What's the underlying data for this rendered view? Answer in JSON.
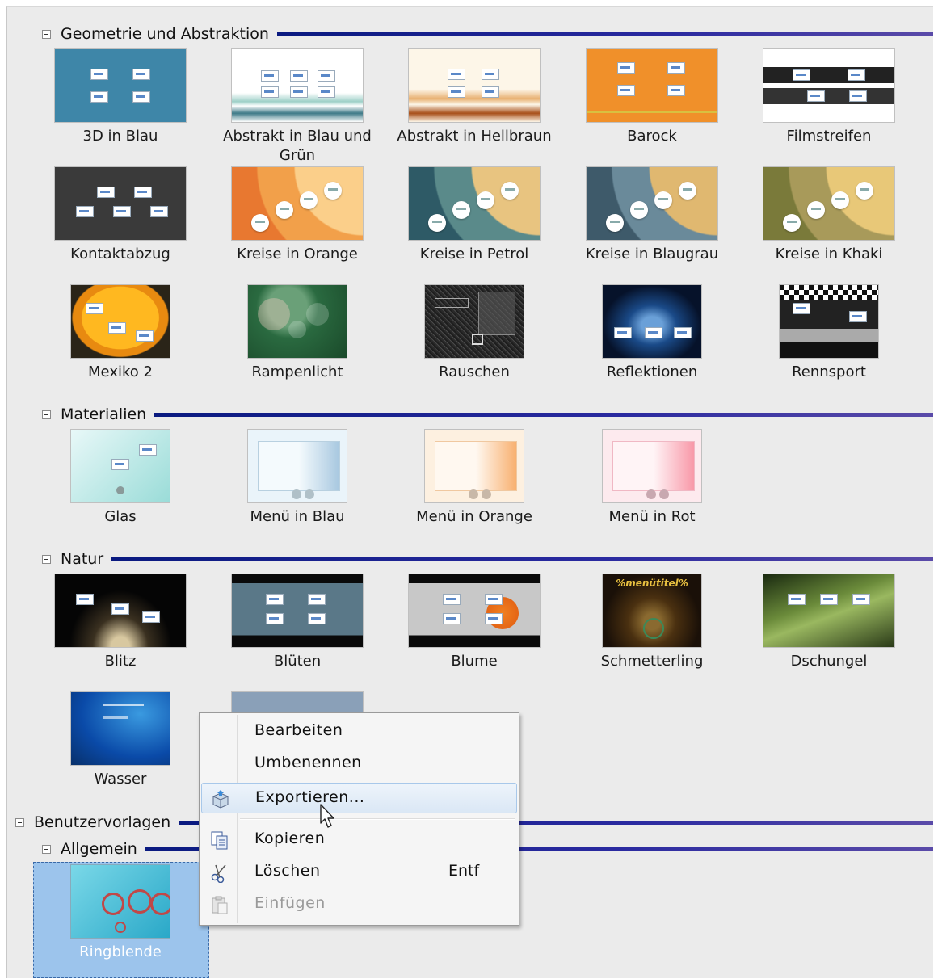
{
  "groups": {
    "geometrie": "Geometrie und Abstraktion",
    "materialien": "Materialien",
    "natur": "Natur",
    "benutzer": "Benutzervorlagen",
    "allgemein": "Allgemein"
  },
  "items": {
    "blau3d": "3D in Blau",
    "abstrakt_blau": "Abstrakt in Blau und Grün",
    "abstrakt_hellbraun": "Abstrakt in Hellbraun",
    "barock": "Barock",
    "filmstreifen": "Filmstreifen",
    "kontaktabzug": "Kontaktabzug",
    "kreise_orange": "Kreise in Orange",
    "kreise_petrol": "Kreise in Petrol",
    "kreise_blaugrau": "Kreise in Blaugrau",
    "kreise_khaki": "Kreise in Khaki",
    "mexiko": "Mexiko 2",
    "rampenlicht": "Rampenlicht",
    "rauschen": "Rauschen",
    "reflektionen": "Reflektionen",
    "rennsport": "Rennsport",
    "glas": "Glas",
    "menu_blau": "Menü in Blau",
    "menu_orange": "Menü in Orange",
    "menu_rot": "Menü in Rot",
    "blitz": "Blitz",
    "blueten": "Blüten",
    "blume": "Blume",
    "schmetterling": "Schmetterling",
    "dschungel": "Dschungel",
    "wasser": "Wasser",
    "ringblende": "Ringblende"
  },
  "schmetterling_thumb_text": "%menütitel%",
  "context_menu": {
    "bearbeiten": "Bearbeiten",
    "umbenennen": "Umbenennen",
    "exportieren": "Exportieren...",
    "kopieren": "Kopieren",
    "loeschen": "Löschen",
    "loeschen_shortcut": "Entf",
    "einfuegen": "Einfügen"
  }
}
